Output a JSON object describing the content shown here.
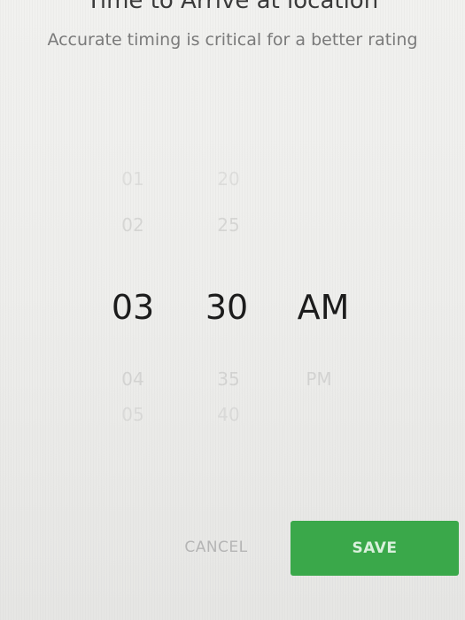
{
  "header": {
    "title": "Time to Arrive at location",
    "subtitle": "Accurate timing is critical for a better rating"
  },
  "picker": {
    "hours": {
      "above": [
        "01",
        "02"
      ],
      "selected": "03",
      "below": [
        "04",
        "05"
      ]
    },
    "minutes": {
      "above": [
        "20",
        "25"
      ],
      "selected": "30",
      "below": [
        "35",
        "40"
      ]
    },
    "period": {
      "selected": "AM",
      "below": [
        "PM"
      ]
    }
  },
  "actions": {
    "cancel_label": "CANCEL",
    "save_label": "SAVE"
  },
  "colors": {
    "accent": "#3aa84a",
    "text_primary": "#1c1c1c",
    "text_secondary": "#7a7a7a"
  }
}
